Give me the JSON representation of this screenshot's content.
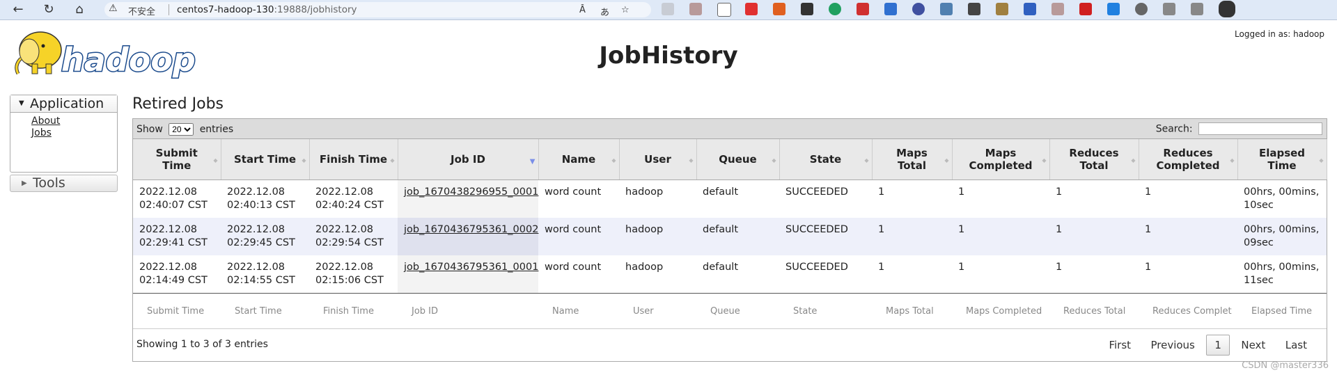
{
  "browser": {
    "warning_text": "不安全",
    "url_host": "centos7-hadoop-130",
    "url_rest": ":19888/jobhistory",
    "addr_icons": [
      "Ȃ",
      "あ",
      "☆"
    ]
  },
  "header": {
    "logo_text": "hadoop",
    "title": "JobHistory",
    "logged_in": "Logged in as: hadoop"
  },
  "sidebar": {
    "application_label": "Application",
    "links": [
      "About",
      "Jobs"
    ],
    "tools_label": "Tools"
  },
  "main": {
    "section_title": "Retired Jobs",
    "show_label": "Show",
    "entries_value": "20",
    "entries_label": "entries",
    "search_label": "Search:",
    "columns": [
      "Submit\nTime",
      "Start Time",
      "Finish Time",
      "Job ID",
      "Name",
      "User",
      "Queue",
      "State",
      "Maps\nTotal",
      "Maps\nCompleted",
      "Reduces\nTotal",
      "Reduces\nCompleted",
      "Elapsed\nTime"
    ],
    "footer_columns": [
      "Submit Time",
      "Start Time",
      "Finish Time",
      "Job ID",
      "Name",
      "User",
      "Queue",
      "State",
      "Maps Total",
      "Maps Completed",
      "Reduces Total",
      "Reduces Complet",
      "Elapsed Time"
    ],
    "rows": [
      [
        "2022.12.08\n02:40:07 CST",
        "2022.12.08\n02:40:13 CST",
        "2022.12.08\n02:40:24 CST",
        "job_1670438296955_0001",
        "word count",
        "hadoop",
        "default",
        "SUCCEEDED",
        "1",
        "1",
        "1",
        "1",
        "00hrs, 00mins,\n10sec"
      ],
      [
        "2022.12.08\n02:29:41 CST",
        "2022.12.08\n02:29:45 CST",
        "2022.12.08\n02:29:54 CST",
        "job_1670436795361_0002",
        "word count",
        "hadoop",
        "default",
        "SUCCEEDED",
        "1",
        "1",
        "1",
        "1",
        "00hrs, 00mins,\n09sec"
      ],
      [
        "2022.12.08\n02:14:49 CST",
        "2022.12.08\n02:14:55 CST",
        "2022.12.08\n02:15:06 CST",
        "job_1670436795361_0001",
        "word count",
        "hadoop",
        "default",
        "SUCCEEDED",
        "1",
        "1",
        "1",
        "1",
        "00hrs, 00mins,\n11sec"
      ]
    ],
    "info": "Showing 1 to 3 of 3 entries",
    "pager": {
      "first": "First",
      "previous": "Previous",
      "current": "1",
      "next": "Next",
      "last": "Last"
    }
  },
  "watermark": "CSDN @master336"
}
